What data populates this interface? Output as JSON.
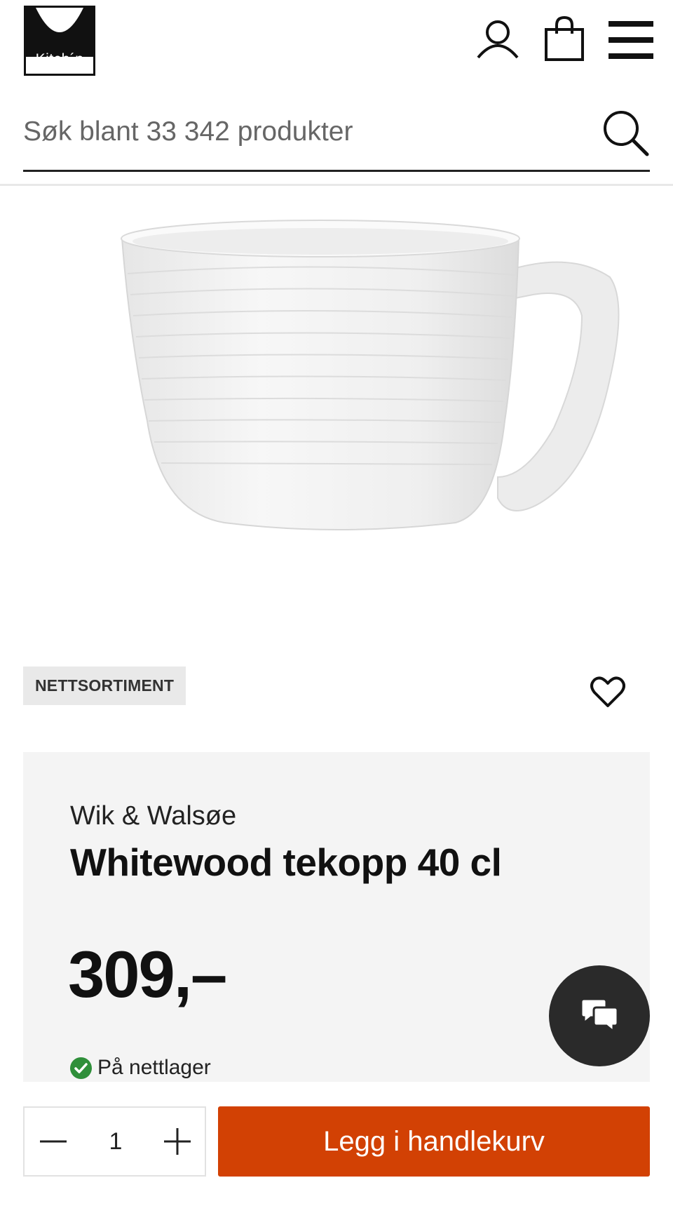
{
  "header": {
    "logo_text": "Kitch´n",
    "icons": {
      "account": "user-icon",
      "cart": "shopping-bag-icon",
      "menu": "hamburger-menu-icon"
    }
  },
  "search": {
    "placeholder": "Søk blant 33 342 produkter",
    "icon": "search-icon"
  },
  "product": {
    "image": "white-textured-mug",
    "badge": "NETTSORTIMENT",
    "favorite_icon": "heart-icon",
    "brand": "Wik & Walsøe",
    "title": "Whitewood tekopp 40 cl",
    "price": "309,–",
    "stock_status": "På nettlager",
    "stock_icon": "check-circle-icon"
  },
  "chat": {
    "icon": "chat-bubbles-icon"
  },
  "purchase": {
    "quantity": "1",
    "minus_icon": "minus-icon",
    "plus_icon": "plus-icon",
    "add_to_cart_label": "Legg i handlekurv"
  },
  "colors": {
    "accent": "#d24104",
    "in_stock": "#2f8f3a",
    "info_background": "#f4f4f4",
    "badge_background": "#e9e9e9",
    "chat_button": "#2a2a2a"
  }
}
